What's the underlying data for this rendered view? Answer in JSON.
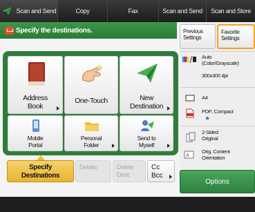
{
  "tabs": [
    "Scan and Send",
    "Copy",
    "Fax",
    "Scan and Send",
    "Scan and Store"
  ],
  "header": {
    "title": "Specify the destinations."
  },
  "destinations": {
    "address_book": [
      "Address",
      "Book"
    ],
    "one_touch": "One-Touch",
    "new_destination": [
      "New",
      "Destination"
    ],
    "mobile_portal": [
      "Mobile",
      "Portal"
    ],
    "personal_folder": [
      "Personal",
      "Folder"
    ],
    "send_to_myself": [
      "Send to",
      "Myself"
    ]
  },
  "bottom": {
    "specify": [
      "Specify",
      "Destinations"
    ],
    "details": "Details",
    "delete": [
      "Delete",
      "Dest."
    ],
    "cc_bcc": [
      "Cc",
      "Bcc"
    ],
    "options": "Options"
  },
  "settings": {
    "previous": [
      "Previous",
      "Settings"
    ],
    "favorite": [
      "Favorite",
      "Settings"
    ],
    "color": [
      "Auto",
      "(Color/Grayscale)"
    ],
    "resolution": "300x300 dpi",
    "size": "A4",
    "format": "PDF; Compact",
    "sided": [
      "2-Sided",
      "Original"
    ],
    "orientation": [
      "Orig. Content",
      "Orientation"
    ]
  },
  "colors": {
    "accent_green": "#2f7c3c",
    "header_green": "#3b9748",
    "specify_yellow": "#eec04a",
    "favorite_border": "#f2a21c"
  }
}
